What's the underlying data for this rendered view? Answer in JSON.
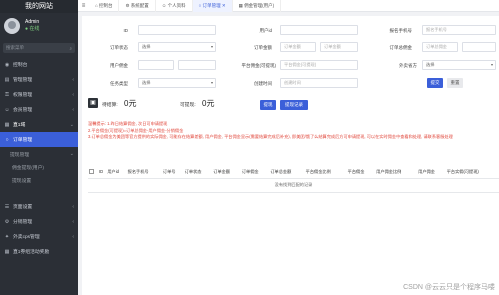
{
  "sidebar": {
    "brand": "我的网站",
    "user_name": "Admin",
    "user_status": "● 在线",
    "search_placeholder": "搜索菜单",
    "items": [
      {
        "icon": "◉",
        "label": "控制台"
      },
      {
        "icon": "▤",
        "label": "管理管理"
      },
      {
        "icon": "⚿",
        "label": "权限管理"
      },
      {
        "icon": "☺",
        "label": "会员管理"
      },
      {
        "icon": "▦",
        "label": "直1域"
      },
      {
        "icon": "○",
        "label": "订单管理"
      },
      {
        "icon": "",
        "label": "提现管理"
      },
      {
        "icon": "",
        "label": "佣金提现(用户)"
      },
      {
        "icon": "",
        "label": "提现设置"
      },
      {
        "icon": "☰",
        "label": "页面设置"
      },
      {
        "icon": "⚙",
        "label": "分销管理"
      },
      {
        "icon": "✦",
        "label": "外卖cps管理"
      },
      {
        "icon": "▦",
        "label": "直1券组活动奖励"
      }
    ]
  },
  "topbar": {
    "tabs": [
      "控制台",
      "系统配置",
      "个人资料",
      "订单管理",
      "佣金管理(用户)"
    ]
  },
  "filters": {
    "id_label": "ID",
    "user_id_label": "用户id",
    "phone_label": "报名手机号",
    "phone_placeholder": "报名手机号",
    "order_status_label": "订单状态",
    "order_status_value": "选择",
    "order_amount_label": "订单金额",
    "order_amount_from": "订单金额",
    "order_amount_to": "订单金额",
    "order_total_label": "订单总佣金",
    "order_total_from": "订单总佣金",
    "user_comm_label": "用户佣金",
    "platform_label": "平台佣金(可提现)",
    "platform_placeholder": "平台佣金(可提现)",
    "takeaway_label": "外卖省方",
    "takeaway_value": "选择",
    "task_type_label": "任务类型",
    "task_type_value": "选择",
    "created_label": "创建时间",
    "created_placeholder": "创建时间",
    "submit": "提交",
    "reset": "重置"
  },
  "wallet": {
    "pending_label": "待结算:",
    "pending_value": "0元",
    "withdrawable_label": "可提现:",
    "withdrawable_value": "0元",
    "withdraw_btn": "提现",
    "records_btn": "提现记录"
  },
  "warnings": [
    "温馨提示: 1.昨日结算佣金, 次日可申请提现",
    "2.平台佣金(可提现)=订单总佣金-用户佣金-分销佣金",
    "3.订单总佣金为美团等官方提供的实际佣金, 可能存在结算差额, 用户佣金, 平台佣金显示(需要结算完成后补充), 即美团/饿了么结算完成后方可申请提现, 可以在实时佣金中查看和处理, 请联系客服处理"
  ],
  "table": {
    "headers": [
      "ID",
      "用户id",
      "报名手机号",
      "订单号",
      "订单状态",
      "订单金额",
      "订单佣金",
      "订单总金额",
      "平台佣金比例",
      "平台佣金",
      "用户佣金比例",
      "用户佣金",
      "平台实佣(可提现)"
    ],
    "empty": "没有找到匹配的记录"
  },
  "watermark": "CSDN @云云只是个程序马喽"
}
